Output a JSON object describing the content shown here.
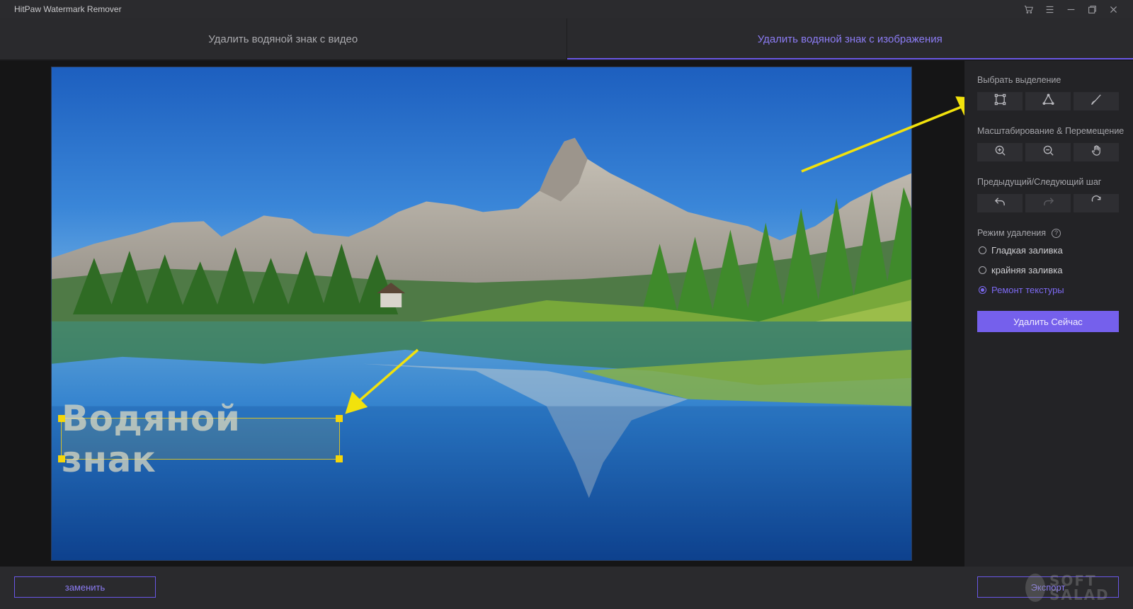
{
  "app": {
    "title": "HitPaw Watermark Remover"
  },
  "window_controls": [
    "cart-icon",
    "menu-icon",
    "minimize-icon",
    "restore-icon",
    "close-icon"
  ],
  "tabs": [
    {
      "label": "Удалить водяной знак с видео",
      "active": false
    },
    {
      "label": "Удалить водяной знак с изображения",
      "active": true
    }
  ],
  "canvas": {
    "watermark_text": "Водяной знак"
  },
  "panel": {
    "select_label": "Выбрать выделение",
    "select_tools": [
      "rectangle-select-icon",
      "polygon-select-icon",
      "brush-icon"
    ],
    "zoom_label": "Масштабирование & Перемещение",
    "zoom_tools": [
      "zoom-in-icon",
      "zoom-out-icon",
      "hand-icon"
    ],
    "step_label": "Предыдущий/Следующий шаг",
    "step_tools": [
      "undo-icon",
      "redo-icon",
      "reset-icon"
    ],
    "mode_label": "Режим удаления",
    "modes": [
      {
        "label": "Гладкая заливка",
        "checked": false
      },
      {
        "label": "крайняя заливка",
        "checked": false
      },
      {
        "label": "Ремонт текстуры",
        "checked": true
      }
    ],
    "remove_button": "Удалить Сейчас"
  },
  "bottom": {
    "replace_button": "заменить",
    "export_button": "Экспорт",
    "overlay_logo_text": "SOFT SALAD"
  },
  "colors": {
    "accent": "#7560ec",
    "accent_text": "#8c7cf4",
    "annotation_arrow": "#f2e20c"
  }
}
